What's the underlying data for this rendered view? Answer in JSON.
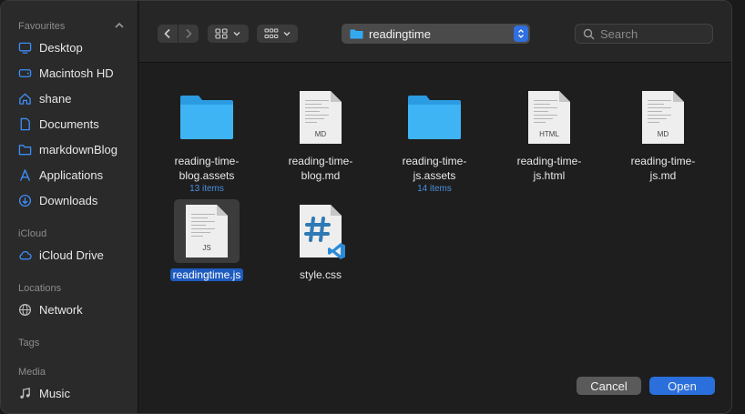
{
  "sidebar": {
    "sections": {
      "favourites": "Favourites",
      "icloud": "iCloud",
      "locations": "Locations",
      "tags": "Tags",
      "media": "Media"
    },
    "favourites": [
      {
        "label": "Desktop",
        "icon": "desktop-icon"
      },
      {
        "label": "Macintosh HD",
        "icon": "hard-drive-icon"
      },
      {
        "label": "shane",
        "icon": "home-icon"
      },
      {
        "label": "Documents",
        "icon": "document-icon"
      },
      {
        "label": "markdownBlog",
        "icon": "folder-icon"
      },
      {
        "label": "Applications",
        "icon": "applications-icon"
      },
      {
        "label": "Downloads",
        "icon": "download-icon"
      }
    ],
    "icloud_items": [
      {
        "label": "iCloud Drive",
        "icon": "cloud-icon"
      }
    ],
    "location_items": [
      {
        "label": "Network",
        "icon": "globe-icon"
      }
    ],
    "media_items": [
      {
        "label": "Music",
        "icon": "music-note-icon"
      }
    ]
  },
  "toolbar": {
    "path": "readingtime",
    "search_placeholder": "Search"
  },
  "files": [
    {
      "line1": "reading-time-",
      "line2": "blog.assets",
      "count": "13 items",
      "kind": "folder"
    },
    {
      "line1": "reading-time-",
      "line2": "blog.md",
      "count": "",
      "kind": "doc",
      "ext": "MD"
    },
    {
      "line1": "reading-time-",
      "line2": "js.assets",
      "count": "14 items",
      "kind": "folder"
    },
    {
      "line1": "reading-time-",
      "line2": "js.html",
      "count": "",
      "kind": "doc",
      "ext": "HTML"
    },
    {
      "line1": "reading-time-",
      "line2": "js.md",
      "count": "",
      "kind": "doc",
      "ext": "MD"
    },
    {
      "line1": "readingtime.js",
      "line2": "",
      "count": "",
      "kind": "doc",
      "ext": "JS",
      "selected": true
    },
    {
      "line1": "style.css",
      "line2": "",
      "count": "",
      "kind": "css"
    }
  ],
  "footer": {
    "cancel_label": "Cancel",
    "open_label": "Open"
  },
  "colors": {
    "accent": "#2a6fdb",
    "folder": "#35a9f0",
    "sidebar_icon": "#3d8ef7"
  }
}
